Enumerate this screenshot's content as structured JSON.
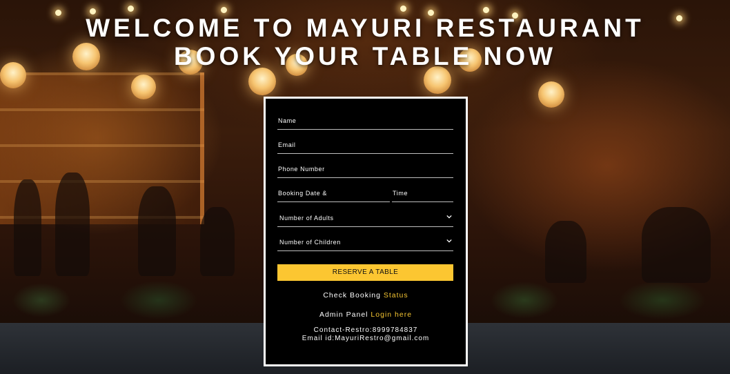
{
  "hero": {
    "line1": "WELCOME TO MAYURI RESTAURANT",
    "line2": "BOOK YOUR TABLE NOW"
  },
  "form": {
    "name_label": "Name",
    "email_label": "Email",
    "phone_label": "Phone Number",
    "date_label": "Booking Date &",
    "time_label": "Time",
    "adults_label": "Number of Adults",
    "children_label": "Number of Children",
    "submit_label": "RESERVE A TABLE"
  },
  "links": {
    "check_text": "Check Booking",
    "check_link": "Status",
    "admin_text": "Admin Panel",
    "admin_link": "Login here"
  },
  "contact": {
    "phone": "Contact-Restro:8999784837",
    "email": "Email id:MayuriRestro@gmail.com"
  },
  "colors": {
    "accent": "#fcc631",
    "card_bg": "#000000",
    "card_border": "#ffffff"
  },
  "icons": {
    "select_chevron": "chevron-down-icon"
  }
}
